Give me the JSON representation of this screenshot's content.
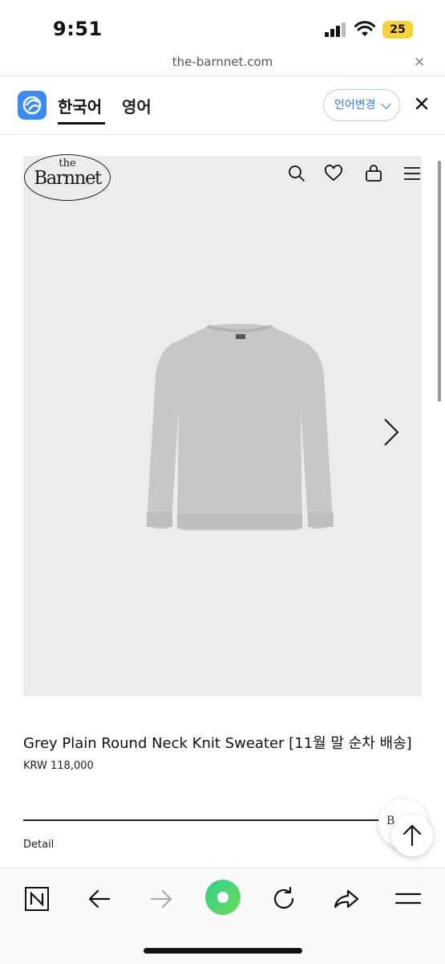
{
  "status_bar": {
    "time": "9:51",
    "battery": "25",
    "icons": [
      "cellular-signal-icon",
      "wifi-icon",
      "battery-icon"
    ]
  },
  "browser": {
    "url": "the-barnnet.com",
    "close_icon": "close-icon"
  },
  "translate_bar": {
    "tabs": [
      {
        "label": "한국어",
        "active": true
      },
      {
        "label": "영어",
        "active": false
      }
    ],
    "change_language_label": "언어변경",
    "accent_color": "#3b7ae0"
  },
  "site_header": {
    "logo": {
      "line1": "the",
      "line2": "Barnnet"
    },
    "icons": [
      "search-icon",
      "heart-icon",
      "shopping-bag-icon",
      "menu-icon"
    ]
  },
  "product": {
    "title": "Grey Plain Round Neck Knit Sweater [11월 말 순차 배송]",
    "price": "KRW 118,000",
    "detail_label": "Detail",
    "image": "grey-knit-sweater",
    "carousel_icon": "chevron-right-icon"
  },
  "floating": {
    "logo_text": "B",
    "scroll_top_icon": "arrow-up-icon"
  },
  "toolbar": {
    "items": [
      "n-logo-icon",
      "back-arrow-icon",
      "forward-arrow-icon",
      "home-circle-icon",
      "reload-icon",
      "share-icon",
      "hamburger-menu-icon"
    ],
    "accent_color": "#3ad07a"
  }
}
